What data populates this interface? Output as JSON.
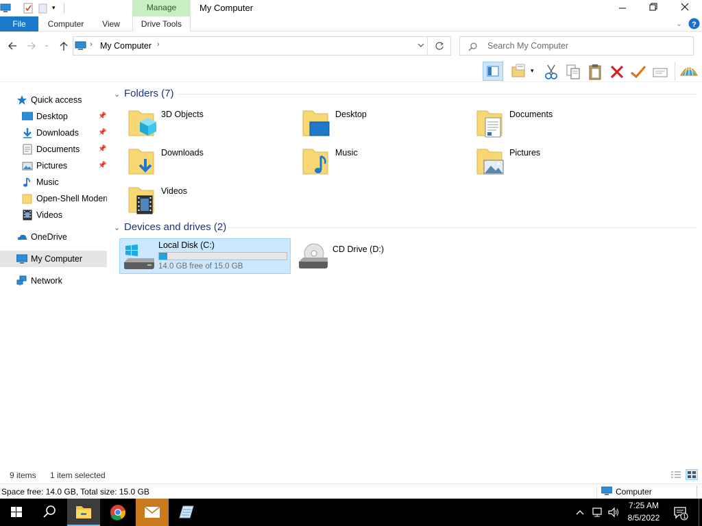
{
  "window": {
    "title": "My Computer",
    "manage_tab": "Manage",
    "controls": {
      "minimize": "minimize-icon",
      "maximize": "restore-icon",
      "close": "close-icon"
    }
  },
  "ribbon": {
    "tabs": [
      "File",
      "Computer",
      "View",
      "Drive Tools"
    ],
    "colors": {
      "file_tab": "#1979ca",
      "manage": "#c7efc1"
    }
  },
  "address": {
    "path": "My Computer",
    "search_placeholder": "Search My Computer"
  },
  "nav": {
    "quick_access": "Quick access",
    "pinned": [
      {
        "label": "Desktop",
        "icon": "desktop-icon",
        "pinned": true
      },
      {
        "label": "Downloads",
        "icon": "downloads-icon",
        "pinned": true
      },
      {
        "label": "Documents",
        "icon": "documents-icon",
        "pinned": true
      },
      {
        "label": "Pictures",
        "icon": "pictures-icon",
        "pinned": true
      },
      {
        "label": "Music",
        "icon": "music-icon",
        "pinned": false
      },
      {
        "label": "Open-Shell Modern",
        "icon": "folder-icon",
        "pinned": false
      },
      {
        "label": "Videos",
        "icon": "videos-icon",
        "pinned": false
      }
    ],
    "onedrive": "OneDrive",
    "my_computer": "My Computer",
    "network": "Network"
  },
  "content": {
    "folders_header": "Folders (7)",
    "folders": [
      {
        "label": "3D Objects",
        "icon": "3d-objects-folder-icon"
      },
      {
        "label": "Desktop",
        "icon": "desktop-folder-icon"
      },
      {
        "label": "Documents",
        "icon": "documents-folder-icon"
      },
      {
        "label": "Downloads",
        "icon": "downloads-folder-icon"
      },
      {
        "label": "Music",
        "icon": "music-folder-icon"
      },
      {
        "label": "Pictures",
        "icon": "pictures-folder-icon"
      },
      {
        "label": "Videos",
        "icon": "videos-folder-icon"
      }
    ],
    "drives_header": "Devices and drives (2)",
    "drives": [
      {
        "label": "Local Disk (C:)",
        "free_text": "14.0 GB free of 15.0 GB",
        "used_fraction": 0.067,
        "selected": true
      },
      {
        "label": "CD Drive (D:)"
      }
    ]
  },
  "status": {
    "items": "9 items",
    "selected": "1 item selected",
    "space": "Space free: 14.0 GB, Total size: 15.0 GB",
    "location": "Computer"
  },
  "taskbar": {
    "time": "7:25 AM",
    "date": "8/5/2022",
    "notifications": "1"
  }
}
